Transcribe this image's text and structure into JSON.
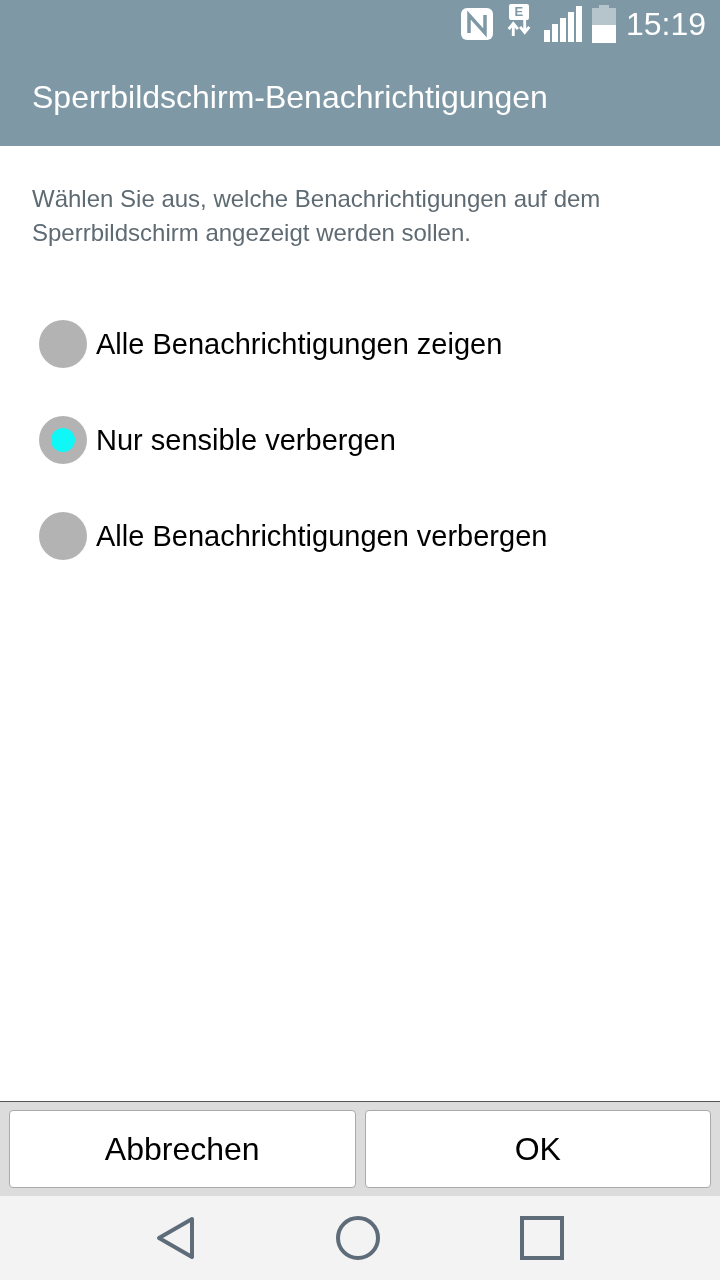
{
  "status_bar": {
    "network_type": "E",
    "time": "15:19"
  },
  "title": "Sperrbildschirm-Benachrichtigungen",
  "description": "Wählen Sie aus, welche Benachrichtigungen auf dem Sperrbildschirm angezeigt werden sollen.",
  "options": [
    {
      "label": "Alle Benachrichtigungen zeigen",
      "selected": false
    },
    {
      "label": "Nur sensible verbergen",
      "selected": true
    },
    {
      "label": "Alle Benachrichtigungen verbergen",
      "selected": false
    }
  ],
  "buttons": [
    "Abbrechen",
    "OK"
  ]
}
